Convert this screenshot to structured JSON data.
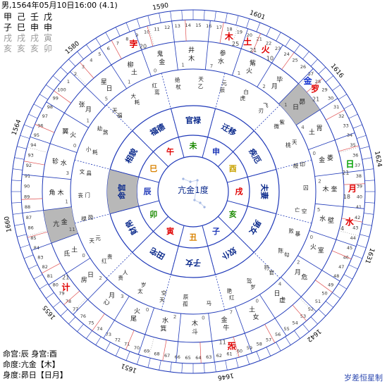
{
  "header": {
    "info": "男,1564年05月10日16:00 (4.1)",
    "pillars": [
      [
        "甲",
        "己",
        "壬",
        "戊"
      ],
      [
        "子",
        "巳",
        "申",
        "申"
      ],
      [
        "戌",
        "戌",
        "戌",
        "寅"
      ],
      [
        "亥",
        "亥",
        "亥",
        "卯"
      ]
    ]
  },
  "footer": {
    "ming_shen": "命宫:辰  身宫:酉",
    "ming_du": "命度:亢金【木】",
    "shen_du": "身度:昴日【日月】",
    "credit": "岁差恒星制"
  },
  "center": {
    "label": "亢金1度"
  },
  "colors": {
    "ring": "#1e38b8",
    "palace": "#0b2a8c",
    "branch_red": "#e00000",
    "branch_orange": "#d98200",
    "branch_green": "#1a8a00",
    "branch_gold": "#c9a200",
    "branch_purple": "#7a3aa0",
    "gray_fill": "#b8b8b8",
    "planet_red": "#e00000",
    "planet_blue": "#1030d0",
    "planet_green": "#00a000"
  },
  "year_marks": [
    "1590",
    "1601",
    "1616",
    "1624",
    "1631",
    "1642",
    "1646",
    "1651",
    "1655",
    "1660",
    "1564",
    "1580"
  ],
  "age_labels": [
    "15",
    "16",
    "17",
    "18",
    "19",
    "20",
    "21",
    "22",
    "23",
    "24",
    "25",
    "26",
    "27",
    "28",
    "29",
    "30",
    "31",
    "32",
    "33",
    "34",
    "35",
    "36",
    "37",
    "38",
    "39",
    "40",
    "41",
    "42",
    "43",
    "44",
    "45",
    "46",
    "47",
    "48",
    "49",
    "50",
    "51",
    "52",
    "53",
    "54",
    "55",
    "56",
    "57",
    "58",
    "59",
    "60",
    "61",
    "62",
    "63",
    "64",
    "65",
    "66",
    "67",
    "68",
    "69",
    "70",
    "71",
    "72",
    "73",
    "74",
    "75",
    "76",
    "77",
    "78",
    "79",
    "80",
    "81",
    "82",
    "83",
    "84",
    "85",
    "86",
    "87",
    "88",
    "89",
    "90",
    "91",
    "92",
    "93",
    "94",
    "95",
    "96",
    "97",
    "98",
    "99",
    "100",
    "1",
    "2",
    "3",
    "4",
    "5",
    "6",
    "7",
    "8",
    "9",
    "10",
    "11",
    "12",
    "13",
    "14"
  ],
  "mansions": [
    {
      "name": "亢金",
      "degree": "11",
      "shade": true
    },
    {
      "name": "角木",
      "degree": "1",
      "shade": false
    },
    {
      "name": "轸水",
      "degree": "3",
      "shade": false
    },
    {
      "name": "翼火",
      "degree": "0",
      "shade": false
    },
    {
      "name": "张月",
      "degree": "1",
      "shade": false
    },
    {
      "name": "星日",
      "degree": "5",
      "shade": false
    },
    {
      "name": "柳土",
      "degree": "1",
      "shade": false
    },
    {
      "name": "鬼金",
      "degree": "0",
      "shade": false
    },
    {
      "name": "井木",
      "degree": "1",
      "shade": false
    },
    {
      "name": "参水",
      "degree": "7",
      "shade": false
    },
    {
      "name": "觜火",
      "degree": "1",
      "shade": false
    },
    {
      "name": "毕月",
      "degree": "2",
      "shade": false
    },
    {
      "name": "昴日",
      "degree": "1",
      "shade": true
    },
    {
      "name": "胃土",
      "degree": "4",
      "shade": false
    },
    {
      "name": "娄金",
      "degree": "0",
      "shade": false
    },
    {
      "name": "奎木",
      "degree": "2",
      "shade": false
    },
    {
      "name": "壁水",
      "degree": "5",
      "shade": false
    },
    {
      "name": "室火",
      "degree": "0",
      "shade": false
    },
    {
      "name": "危月",
      "degree": "2",
      "shade": false
    },
    {
      "name": "虚日",
      "degree": "4",
      "shade": false
    },
    {
      "name": "女土",
      "degree": "0",
      "shade": false
    },
    {
      "name": "牛金",
      "degree": "7",
      "shade": false
    },
    {
      "name": "斗木",
      "degree": "0",
      "shade": false
    },
    {
      "name": "箕水",
      "degree": "2",
      "shade": false
    },
    {
      "name": "尾火",
      "degree": "0",
      "shade": false
    },
    {
      "name": "心月",
      "degree": "3",
      "shade": false
    },
    {
      "name": "房日",
      "degree": "2",
      "shade": false
    },
    {
      "name": "氐土",
      "degree": "0",
      "shade": false
    }
  ],
  "planets": [
    {
      "name": "孛",
      "color": "#e00000",
      "num": "20",
      "angle": 112
    },
    {
      "name": "木",
      "color": "#e00000",
      "num": "25",
      "angle": 77
    },
    {
      "name": "土",
      "color": "#e00000",
      "num": "21",
      "angle": 70
    },
    {
      "name": "火",
      "color": "#e00000",
      "num": "10",
      "angle": 63
    },
    {
      "name": "金",
      "color": "#1030d0",
      "num": "",
      "angle": 44
    },
    {
      "name": "罗",
      "color": "#e00000",
      "num": "21",
      "angle": 40
    },
    {
      "name": "日",
      "color": "#00a000",
      "num": "21",
      "angle": 10
    },
    {
      "name": "月",
      "color": "#e00000",
      "num": "18",
      "angle": 1
    },
    {
      "name": "水",
      "color": "#e00000",
      "num": "4",
      "angle": -11
    },
    {
      "name": "炁",
      "color": "#e00000",
      "num": "11",
      "angle": -76
    },
    {
      "name": "计",
      "color": "#e00000",
      "num": "21",
      "angle": -143
    }
  ],
  "shensha": [
    "文昌",
    "小耗",
    "劫煞",
    "天福",
    "大耗",
    "红鸾",
    "绝杖",
    "天乙",
    "元辰",
    "白虎",
    "飞刃",
    "紫微",
    "天桃",
    "印绶",
    "囚",
    "空亡",
    "暴败",
    "勾陈",
    "官符",
    "岁驾",
    "红艳",
    "马",
    "孤辰",
    "天空",
    "太岁",
    "贵人",
    "红贵",
    "天元",
    "禄勋",
    "丧门"
  ],
  "palaces": [
    {
      "name": "命宫",
      "shade": true
    },
    {
      "name": "相貌",
      "shade": false
    },
    {
      "name": "福德",
      "shade": false
    },
    {
      "name": "官禄",
      "shade": false
    },
    {
      "name": "迁移",
      "shade": false
    },
    {
      "name": "疾厄",
      "shade": false
    },
    {
      "name": "夫妻",
      "shade": false
    },
    {
      "name": "男女",
      "shade": false
    },
    {
      "name": "奴仆",
      "shade": false
    },
    {
      "name": "子女",
      "shade": false
    },
    {
      "name": "田宅",
      "shade": false
    },
    {
      "name": "财帛",
      "shade": false
    }
  ],
  "branches": [
    {
      "name": "辰",
      "color": "#1e38b8"
    },
    {
      "name": "巳",
      "color": "#d98200"
    },
    {
      "name": "午",
      "color": "#e00000"
    },
    {
      "name": "未",
      "color": "#1a8a00"
    },
    {
      "name": "申",
      "color": "#1e38b8"
    },
    {
      "name": "酉",
      "color": "#c9a200"
    },
    {
      "name": "戌",
      "color": "#e00000"
    },
    {
      "name": "亥",
      "color": "#1a8a00"
    },
    {
      "name": "子",
      "color": "#1e38b8"
    },
    {
      "name": "丑",
      "color": "#d98200"
    },
    {
      "name": "寅",
      "color": "#e00000"
    },
    {
      "name": "卯",
      "color": "#1a8a00"
    }
  ]
}
